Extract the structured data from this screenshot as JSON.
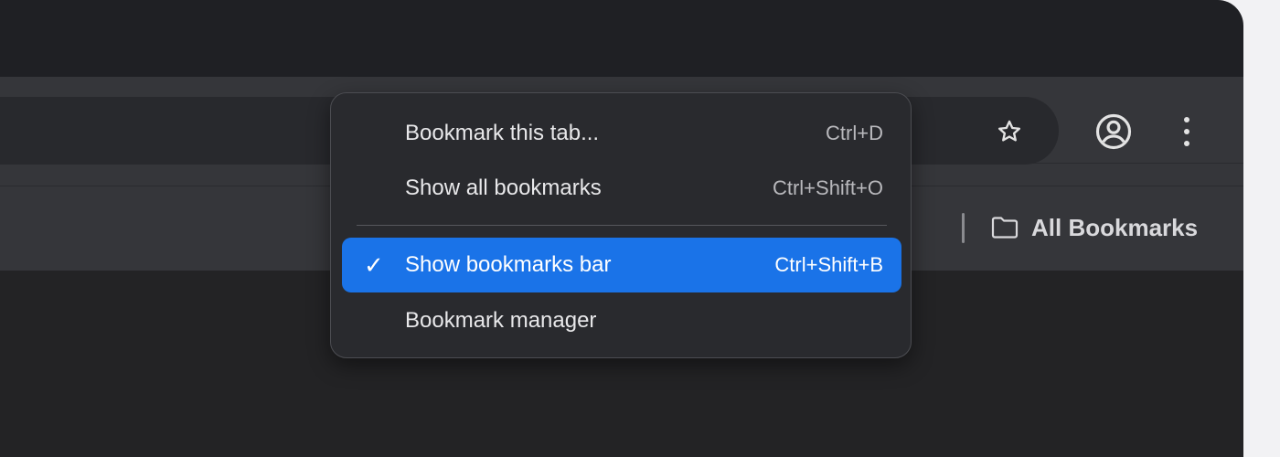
{
  "colors": {
    "window_bg": "#1f2024",
    "toolbar_bg": "#35363a",
    "omnibox_bg": "#28292d",
    "menu_bg": "#292a2e",
    "menu_selected": "#1a73e8",
    "text_primary": "#e8e8ea",
    "text_secondary": "#b8b8bc"
  },
  "toolbar": {
    "star_icon": "star-icon",
    "profile_icon": "account-circle-icon",
    "menu_icon": "kebab-menu-icon"
  },
  "bookmarks_bar": {
    "all_bookmarks_label": "All Bookmarks",
    "folder_icon": "folder-icon"
  },
  "bookmark_menu": {
    "items": [
      {
        "label": "Bookmark this tab...",
        "shortcut": "Ctrl+D",
        "checked": false
      },
      {
        "label": "Show all bookmarks",
        "shortcut": "Ctrl+Shift+O",
        "checked": false
      },
      {
        "label": "Show bookmarks bar",
        "shortcut": "Ctrl+Shift+B",
        "checked": true,
        "check_mark": "✓"
      },
      {
        "label": "Bookmark manager",
        "shortcut": "",
        "checked": false
      }
    ]
  }
}
